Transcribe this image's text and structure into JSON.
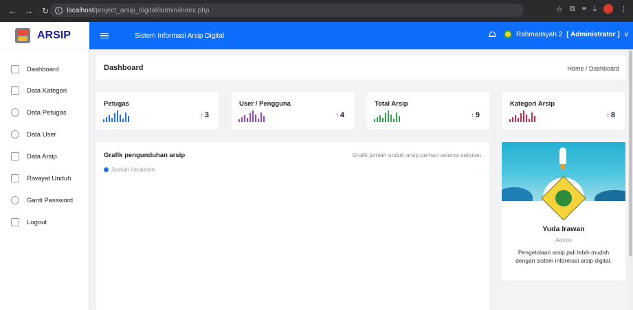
{
  "browser": {
    "url_host": "localhost",
    "url_path": "/project_arsip_digital/admin/index.php",
    "back_icon": "arrow-left-icon",
    "forward_icon": "arrow-right-icon",
    "reload_icon": "reload-icon"
  },
  "app": {
    "brand": "ARSIP",
    "title": "Sistem Informasi Arsip Digital"
  },
  "user": {
    "name": "Rahmadsyah 2",
    "role": "[ Administrator ]",
    "caret": "∨"
  },
  "sidebar": {
    "items": [
      {
        "label": "Dashboard",
        "icon": "home-icon"
      },
      {
        "label": "Data Kategori",
        "icon": "folder-icon"
      },
      {
        "label": "Data Petugas",
        "icon": "user-icon"
      },
      {
        "label": "Data User",
        "icon": "user-icon"
      },
      {
        "label": "Data Arsip",
        "icon": "file-icon"
      },
      {
        "label": "Riwayat Unduh",
        "icon": "list-icon"
      },
      {
        "label": "Ganti Password",
        "icon": "lock-icon"
      },
      {
        "label": "Logout",
        "icon": "logout-icon"
      }
    ]
  },
  "page": {
    "title": "Dashboard",
    "breadcrumb": "Home / Dashboard"
  },
  "stats": [
    {
      "label": "Petugas",
      "value": "3",
      "color": "#1e74e8"
    },
    {
      "label": "User / Pengguna",
      "value": "4",
      "color": "#9b3fcf"
    },
    {
      "label": "Total Arsip",
      "value": "9",
      "color": "#2ea44f"
    },
    {
      "label": "Kategori Arsip",
      "value": "8",
      "color": "#d8234a"
    }
  ],
  "chart": {
    "title": "Grafik pengunduhan arsip",
    "subtitle": "Grafik jumlah unduh arsip perhari selama sebulan",
    "legend": "Jumlah Unduhan",
    "legend_color": "#1f6fe5"
  },
  "profile": {
    "name": "Yuda Irawan",
    "role": "Admin",
    "description": "Pengelolaan arsip jadi lebih mudah dengan sistem informasi arsip digital."
  }
}
